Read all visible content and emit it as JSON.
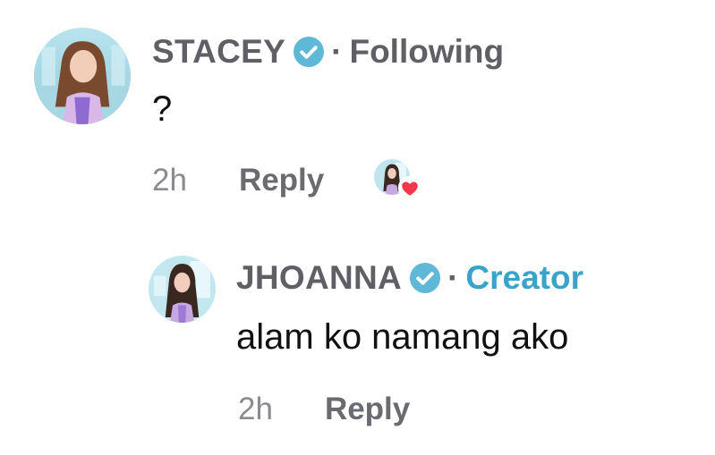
{
  "comments": [
    {
      "username": "STACEY",
      "verified": true,
      "relation": "Following",
      "separator": "·",
      "text": "?",
      "time": "2h",
      "reply_label": "Reply",
      "liked_by_creator": true,
      "avatar_icon": "user-avatar-photo"
    }
  ],
  "replies": [
    {
      "username": "JHOANNA",
      "verified": true,
      "relation": "Creator",
      "separator": "·",
      "text": "alam ko namang ako",
      "time": "2h",
      "reply_label": "Reply",
      "avatar_icon": "creator-avatar-photo"
    }
  ],
  "colors": {
    "username": "#5f5f65",
    "verified_badge": "#5fb8d6",
    "creator_label": "#3aa3c9",
    "heart": "#f2384c",
    "time": "#8a8b91",
    "reply": "#6a6b70"
  },
  "icons": {
    "verified": "verified-badge-icon",
    "heart": "heart-icon"
  }
}
